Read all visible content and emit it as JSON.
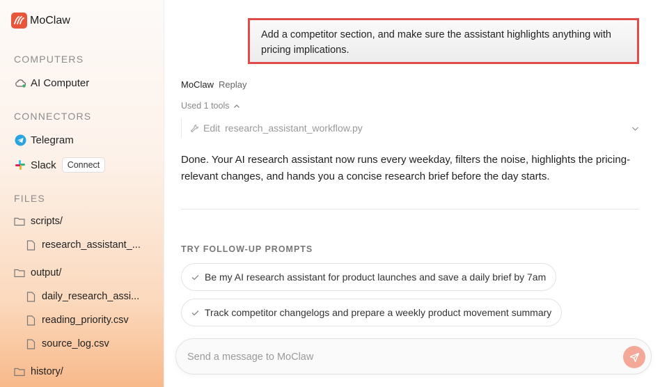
{
  "brand": {
    "name": "MoClaw",
    "logo_color": "#e8553a"
  },
  "sidebar": {
    "computers_title": "COMPUTERS",
    "computers": [
      {
        "label": "AI Computer",
        "icon": "cloud-icon"
      }
    ],
    "connectors_title": "CONNECTORS",
    "connectors": [
      {
        "label": "Telegram",
        "icon": "telegram-icon"
      },
      {
        "label": "Slack",
        "icon": "slack-icon",
        "action": "Connect"
      }
    ],
    "files_title": "FILES",
    "files": [
      {
        "label": "scripts/",
        "type": "folder"
      },
      {
        "label": "research_assistant_...",
        "type": "file"
      },
      {
        "label": "output/",
        "type": "folder"
      },
      {
        "label": "daily_research_assi...",
        "type": "file"
      },
      {
        "label": "reading_priority.csv",
        "type": "file"
      },
      {
        "label": "source_log.csv",
        "type": "file"
      },
      {
        "label": "history/",
        "type": "folder"
      }
    ]
  },
  "chat": {
    "user_message": "Add a competitor section, and make sure the assistant highlights anything with pricing implications.",
    "assistant_name": "MoClaw",
    "replay_label": "Replay",
    "tools_used_label": "Used 1 tools",
    "tool_action": "Edit",
    "tool_file": "research_assistant_workflow.py",
    "answer": "Done. Your AI research assistant now runs every weekday, filters the noise, highlights the pricing-relevant changes, and hands you a concise research brief before the day starts.",
    "followup_title": "TRY FOLLOW-UP PROMPTS",
    "followups": [
      "Be my AI research assistant for product launches and save a daily brief by 7am",
      "Track competitor changelogs and prepare a weekly product movement summary"
    ]
  },
  "composer": {
    "placeholder": "Send a message to MoClaw",
    "value": ""
  },
  "colors": {
    "accent": "#e8553a",
    "highlight_border": "#e04b4b",
    "send_button": "#f3a898"
  }
}
